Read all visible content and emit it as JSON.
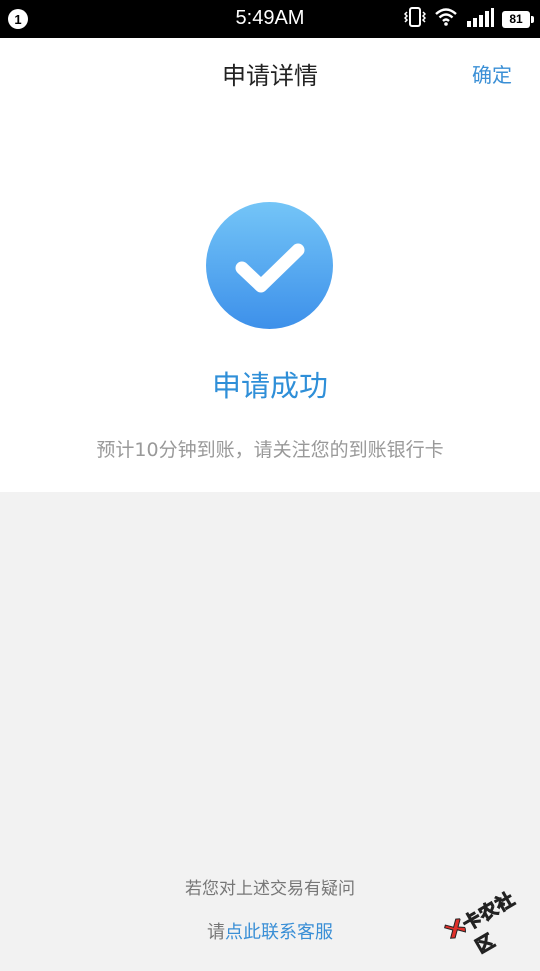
{
  "status_bar": {
    "notification_count": "1",
    "time": "5:49AM",
    "battery_level": "81",
    "icons": [
      "vibrate-icon",
      "wifi-icon",
      "signal-icon",
      "battery-icon"
    ]
  },
  "header": {
    "title": "申请详情",
    "confirm_label": "确定"
  },
  "result": {
    "icon": "check-circle-icon",
    "title": "申请成功",
    "description": "预计10分钟到账，请关注您的到账银行卡"
  },
  "footer": {
    "question": "若您对上述交易有疑问",
    "contact_prefix": "请",
    "contact_link": "点此联系客服"
  },
  "watermark": {
    "text": "卡农社区"
  },
  "colors": {
    "accent": "#3a8fd6",
    "background": "#f2f2f2",
    "status_bar": "#000000"
  }
}
